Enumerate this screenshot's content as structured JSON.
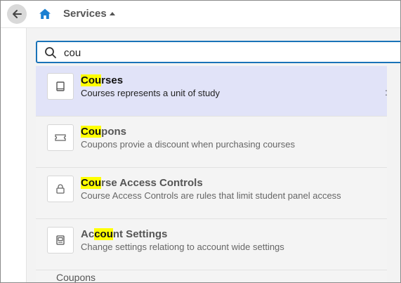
{
  "header": {
    "back_icon": "arrow-left-icon",
    "home_icon": "home-icon",
    "services_label": "Services",
    "services_caret": "caret-up-icon"
  },
  "search": {
    "icon": "search-icon",
    "value": "cou",
    "placeholder": ""
  },
  "results": [
    {
      "icon": "book-icon",
      "title_pre": "",
      "title_match": "Cou",
      "title_post": "rses",
      "description": "Courses represents a unit of study",
      "selected": true
    },
    {
      "icon": "ticket-icon",
      "title_pre": "",
      "title_match": "Cou",
      "title_post": "pons",
      "description": "Coupons provie a discount when purchasing courses",
      "selected": false
    },
    {
      "icon": "lock-icon",
      "title_pre": "",
      "title_match": "Cou",
      "title_post": "rse Access Controls",
      "description": "Course Access Controls are rules that limit student panel access",
      "selected": false
    },
    {
      "icon": "settings-panel-icon",
      "title_pre": "Ac",
      "title_match": "cou",
      "title_post": "nt Settings",
      "description": "Change settings relationg to account wide settings",
      "selected": false
    }
  ],
  "more_label": "Coupons",
  "kebab": ":",
  "colors": {
    "accent": "#1a73b8",
    "highlight": "#ffff00",
    "selected_bg": "#e1e3f8"
  }
}
